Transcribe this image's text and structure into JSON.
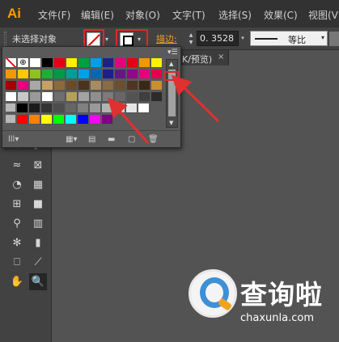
{
  "app": {
    "logo": "Ai"
  },
  "menu": [
    {
      "label": "文件(F)"
    },
    {
      "label": "编辑(E)"
    },
    {
      "label": "对象(O)"
    },
    {
      "label": "文字(T)"
    },
    {
      "label": "选择(S)"
    },
    {
      "label": "效果(C)"
    },
    {
      "label": "视图(V)"
    }
  ],
  "control_bar": {
    "selection_text": "未选择对象",
    "fill_state": "none",
    "stroke_state": "default",
    "stroke_label": "描边:",
    "stroke_weight": "0. 3528",
    "profile_label": "等比",
    "colors": {
      "accent": "#ff9a00",
      "highlight": "#e02828"
    }
  },
  "document_tab": {
    "label": "K/预览)",
    "close": "×"
  },
  "swatches_panel": {
    "menu_icon": "panel-menu-icon",
    "row1": [
      "none",
      "registration",
      "#ffffff",
      "#000000",
      "#e60012",
      "#fff100",
      "#00a040",
      "#00a0e9",
      "#1d2088",
      "#e4007f",
      "#e60012",
      "#f39800",
      "#fff100"
    ],
    "row2": [
      "#f39800",
      "#fcc800",
      "#8fc31f",
      "#22ac38",
      "#009944",
      "#009e96",
      "#00a0e9",
      "#0068b7",
      "#1d2088",
      "#601986",
      "#920783",
      "#e4007f",
      "#e5004f"
    ],
    "row3": [
      "#a40000",
      "#e4007f",
      "#a8a8a8",
      "#c9a063",
      "#8c6a3f",
      "#6a4a2b",
      "#4a321d",
      "#a88b62",
      "#8a6b45",
      "#6b4f2e",
      "#4f3621",
      "#3a2817",
      "#c89030"
    ],
    "row4": [
      "#ffffff",
      "#c8c8c8",
      "#9a9a9a",
      "#ffffff",
      "#6e6e6e",
      "#b5a05a",
      "#a3a3a3",
      "#8f8f8f",
      "#7b7b7b",
      "#676767",
      "#535353",
      "#3f3f3f",
      "#2b2b2b"
    ],
    "row5": [
      "#000000",
      "#1a1a1a",
      "#333333",
      "#4d4d4d",
      "#666666",
      "#808080",
      "#999999",
      "#b3b3b3",
      "#cccccc",
      "#e6e6e6",
      "#ffffff"
    ],
    "row6": [
      "#ff0000",
      "#ff8000",
      "#ffff00",
      "#00ff00",
      "#00ffff",
      "#0000ff",
      "#ff00ff",
      "#800080"
    ],
    "bottom_icons": [
      "swatch-library-icon",
      "show-kinds-icon",
      "swatch-options-icon",
      "new-color-group-icon",
      "new-swatch-icon",
      "delete-swatch-icon"
    ]
  },
  "tools": [
    "pen-icon",
    "pencil-icon",
    "brush-icon",
    "eraser-icon",
    "rotate-icon",
    "scale-icon",
    "width-icon",
    "free-transform-icon",
    "shape-builder-icon",
    "perspective-icon",
    "mesh-icon",
    "gradient-icon",
    "eyedropper-icon",
    "blend-icon",
    "symbol-icon",
    "graph-icon",
    "artboard-icon",
    "slice-icon",
    "hand-icon",
    "zoom-icon"
  ],
  "watermark": {
    "title": "查询啦",
    "url": "chaxunla.com"
  }
}
